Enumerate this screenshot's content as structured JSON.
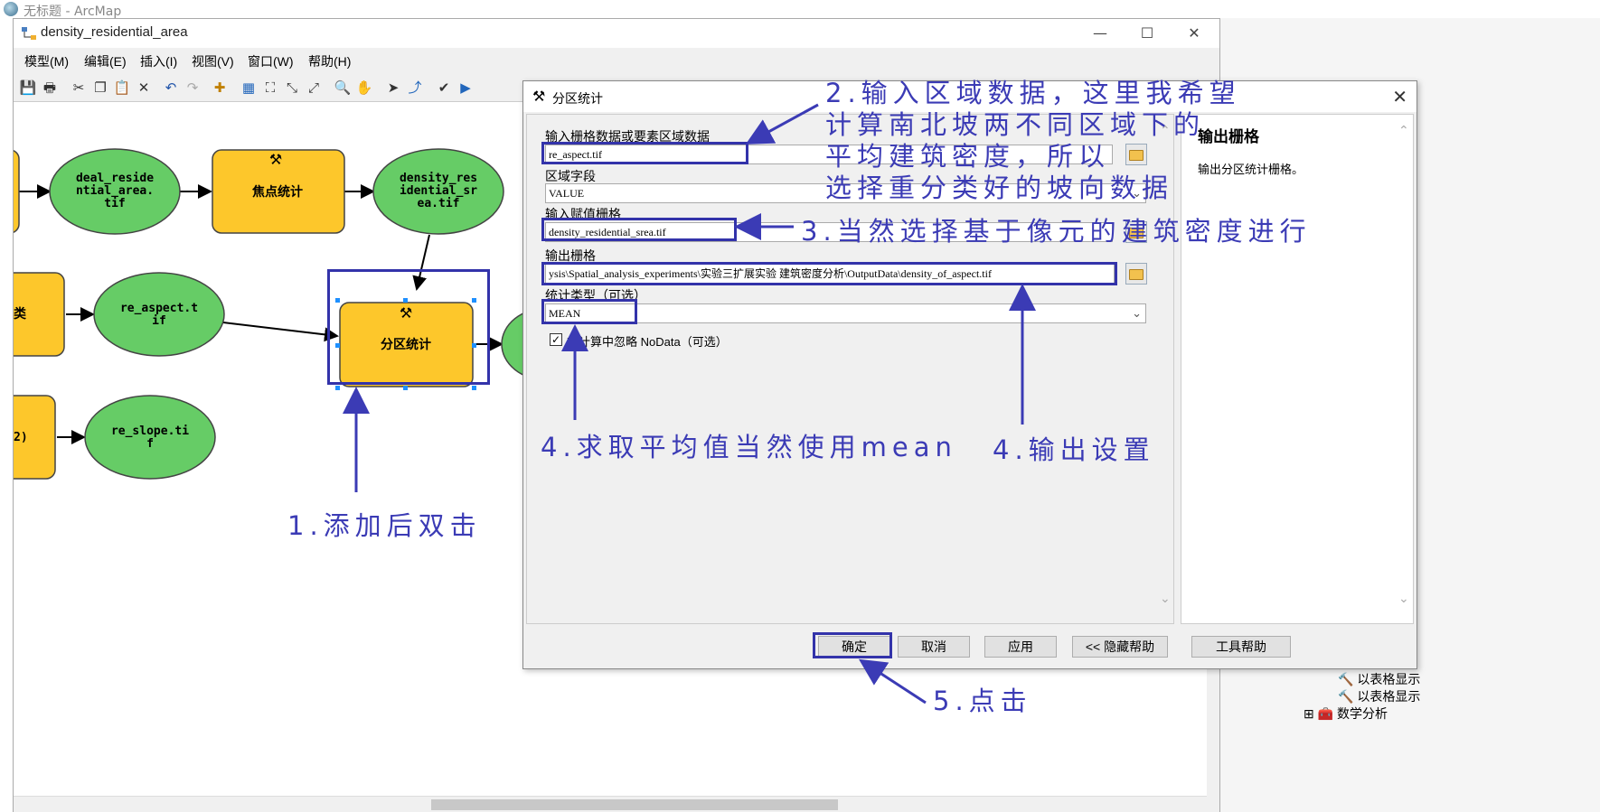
{
  "background_app": {
    "title": "无标题 - ArcMap"
  },
  "model_window": {
    "title": "density_residential_area",
    "menu": [
      "模型(M)",
      "编辑(E)",
      "插入(I)",
      "视图(V)",
      "窗口(W)",
      "帮助(H)"
    ]
  },
  "model": {
    "nodes": {
      "deal_residential": "deal_reside\nntial_area.\ntif",
      "focal_stats": "焦点统计",
      "density_out": "density_res\nidential_sr\nea.tif",
      "re_aspect": "re_aspect.t\nif",
      "zonal_stats": "分区统计",
      "re_slope": "re_slope.ti\nf",
      "left_tool_2": "类",
      "left_tool_3": "2)"
    }
  },
  "dialog": {
    "title": "分区统计",
    "fields": {
      "zone_label": "输入栅格数据或要素区域数据",
      "zone_value": "re_aspect.tif",
      "zone_field_label": "区域字段",
      "zone_field_value": "VALUE",
      "value_raster_label": "输入赋值栅格",
      "value_raster_value": "density_residential_srea.tif",
      "output_label": "输出栅格",
      "output_value": "ysis\\Spatial_analysis_experiments\\实验三扩展实验 建筑密度分析\\OutputData\\density_of_aspect.tif",
      "stat_type_label": "统计类型（可选）",
      "stat_type_value": "MEAN",
      "ignore_nodata_label": "在计算中忽略 NoData（可选）"
    },
    "help": {
      "title": "输出栅格",
      "text": "输出分区统计栅格。"
    },
    "buttons": {
      "ok": "确定",
      "cancel": "取消",
      "apply": "应用",
      "hide_help": "<< 隐藏帮助",
      "tool_help": "工具帮助"
    }
  },
  "right_panel": {
    "items": [
      "以表格显示",
      "以表格显示",
      "数学分析"
    ]
  },
  "annotations": {
    "a1": "1.添加后双击",
    "a2_l1": "2.输入区域数据，这里我希望",
    "a2_l2": "计算南北坡两不同区域下的",
    "a2_l3": "平均建筑密度，所以",
    "a2_l4": "选择重分类好的坡向数据",
    "a3": "3.当然选择基于像元的建筑密度进行",
    "a4_mean": "4.求取平均值当然使用mean",
    "a4_out": "4.输出设置",
    "a5": "5.点击"
  },
  "colors": {
    "annotation": "#3b3bb5",
    "tool_node": "#fdc72b",
    "data_node": "#66cc66"
  }
}
